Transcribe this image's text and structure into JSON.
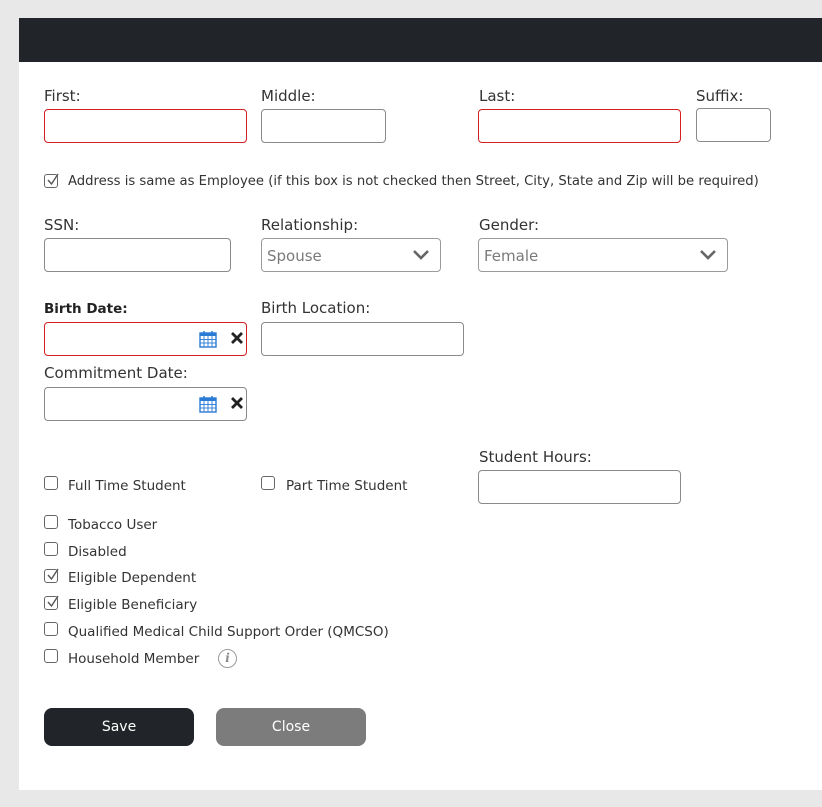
{
  "form": {
    "first_label": "First:",
    "middle_label": "Middle:",
    "last_label": "Last:",
    "suffix_label": "Suffix:",
    "address_same_label": "Address is same as Employee  (if this box is not checked then Street, City, State and Zip will be required)",
    "address_same_checked": true,
    "ssn_label": "SSN:",
    "relationship_label": "Relationship:",
    "relationship_value": "Spouse",
    "gender_label": "Gender:",
    "gender_value": "Female",
    "birth_date_label": "Birth Date:",
    "birth_location_label": "Birth Location:",
    "commitment_date_label": "Commitment Date:",
    "student_hours_label": "Student Hours:",
    "checkboxes": [
      {
        "label": "Full Time Student",
        "checked": false
      },
      {
        "label": "Part Time Student",
        "checked": false
      },
      {
        "label": "Tobacco User",
        "checked": false
      },
      {
        "label": "Disabled",
        "checked": false
      },
      {
        "label": "Eligible Dependent",
        "checked": true
      },
      {
        "label": "Eligible Beneficiary",
        "checked": true
      },
      {
        "label": "Qualified Medical Child Support Order (QMCSO)",
        "checked": false
      },
      {
        "label": "Household Member",
        "checked": false
      }
    ]
  },
  "buttons": {
    "save_label": "Save",
    "close_label": "Close"
  },
  "colors": {
    "dark": "#212529",
    "required_border": "#d42020",
    "close_button": "#7c7c7c",
    "calendar_icon": "#2b7bd6"
  }
}
